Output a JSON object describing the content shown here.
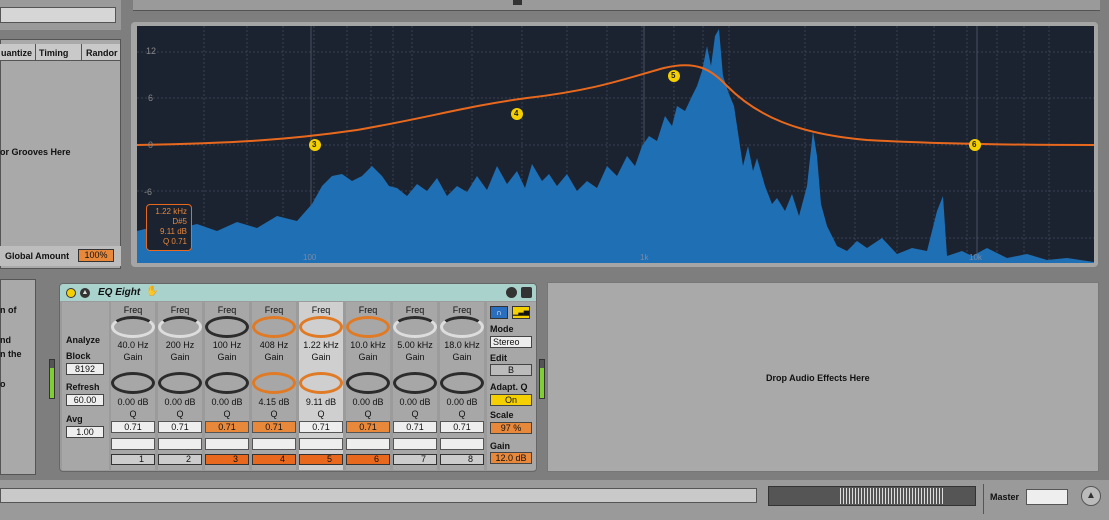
{
  "groove": {
    "columns": [
      "uantize",
      "Timing",
      "Randor"
    ],
    "drop_text": "or Grooves Here",
    "global_amount_label": "Global Amount",
    "global_amount_value": "100%"
  },
  "left_fragment": {
    "lines": [
      "n of",
      "nd",
      "n the",
      "o"
    ]
  },
  "eq_display": {
    "y_labels": [
      "12",
      "6",
      "0",
      "-6"
    ],
    "x_labels": [
      "100",
      "1k",
      "10k"
    ],
    "nodes": [
      "3",
      "4",
      "5",
      "6"
    ],
    "tooltip": [
      "1.22 kHz",
      "D#5",
      "9.11 dB",
      "Q 0.71"
    ]
  },
  "device": {
    "title": "EQ Eight",
    "analyze_label": "Analyze",
    "block_label": "Block",
    "block_value": "8192",
    "refresh_label": "Refresh",
    "refresh_value": "60.00",
    "avg_label": "Avg",
    "avg_value": "1.00",
    "freq_label": "Freq",
    "gain_label": "Gain",
    "q_label": "Q",
    "bands": [
      {
        "num": "1",
        "freq": "40.0 Hz",
        "gain": "0.00 dB",
        "q": "0.71",
        "on": false
      },
      {
        "num": "2",
        "freq": "200 Hz",
        "gain": "0.00 dB",
        "q": "0.71",
        "on": false
      },
      {
        "num": "3",
        "freq": "100 Hz",
        "gain": "0.00 dB",
        "q": "0.71",
        "on": true
      },
      {
        "num": "4",
        "freq": "408 Hz",
        "gain": "4.15 dB",
        "q": "0.71",
        "on": true
      },
      {
        "num": "5",
        "freq": "1.22 kHz",
        "gain": "9.11 dB",
        "q": "0.71",
        "on": true
      },
      {
        "num": "6",
        "freq": "10.0 kHz",
        "gain": "0.00 dB",
        "q": "0.71",
        "on": true
      },
      {
        "num": "7",
        "freq": "5.00 kHz",
        "gain": "0.00 dB",
        "q": "0.71",
        "on": false
      },
      {
        "num": "8",
        "freq": "18.0 kHz",
        "gain": "0.00 dB",
        "q": "0.71",
        "on": false
      }
    ],
    "mode_label": "Mode",
    "mode_value": "Stereo",
    "edit_label": "Edit",
    "edit_value": "B",
    "adapt_label": "Adapt. Q",
    "adapt_value": "On",
    "scale_label": "Scale",
    "scale_value": "97 %",
    "gain_out_label": "Gain",
    "gain_out_value": "12.0 dB"
  },
  "drop_audio_text": "Drop Audio Effects Here",
  "footer": {
    "master_label": "Master"
  },
  "colors": {
    "accent": "#e8883b",
    "spectrum": "#1e6fb3",
    "curve": "#e8691e",
    "node": "#f5d000",
    "header": "#a9d2cd"
  }
}
